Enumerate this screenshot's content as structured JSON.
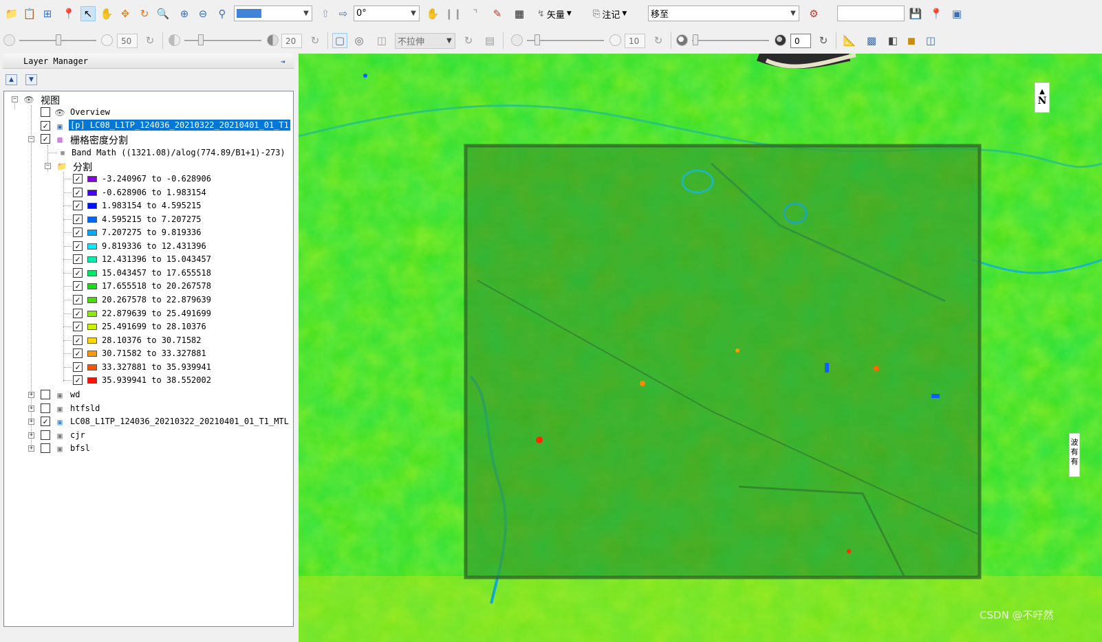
{
  "toolbar_top": {
    "icons": [
      "open-folder-icon",
      "clipboard-icon",
      "crop-icon",
      "pushpin-icon",
      "select-arrow-icon",
      "hand-pan-icon",
      "move-icon",
      "rotate-icon",
      "zoom-icon",
      "zoom-in-icon",
      "zoom-out-icon",
      "zoom-extent-icon"
    ],
    "zoom_combo_value": "",
    "rotation_combo_value": "0°",
    "vector_label": "矢量",
    "annotation_label": "注记",
    "goto_combo_value": "移至",
    "goto_input_value": ""
  },
  "toolbar_bottom": {
    "brightness_value": "50",
    "contrast_value": "20",
    "stretch_combo_value": "不拉伸",
    "sharpen_value": "10",
    "transparency_value": "0"
  },
  "layer_manager": {
    "title": "Layer Manager",
    "tree": {
      "root_label": "视图",
      "overview_label": "Overview",
      "selected_layer_label": "[p] LC08_L1TP_124036_20210322_20210401_01_T1",
      "density_slice_label": "栅格密度分割",
      "band_math_label": "Band Math ((1321.08)/alog(774.89/B1+1)-273)",
      "slices_folder_label": "分割",
      "slices": [
        {
          "label": "-3.240967 to -0.628906",
          "color": "#8a00e6"
        },
        {
          "label": "-0.628906 to 1.983154",
          "color": "#4400ff"
        },
        {
          "label": "1.983154 to 4.595215",
          "color": "#0011ff"
        },
        {
          "label": "4.595215 to 7.207275",
          "color": "#0066ff"
        },
        {
          "label": "7.207275 to 9.819336",
          "color": "#00aaff"
        },
        {
          "label": "9.819336 to 12.431396",
          "color": "#00eeff"
        },
        {
          "label": "12.431396 to 15.043457",
          "color": "#00f0b0"
        },
        {
          "label": "15.043457 to 17.655518",
          "color": "#00e666"
        },
        {
          "label": "17.655518 to 20.267578",
          "color": "#11e011"
        },
        {
          "label": "20.267578 to 22.879639",
          "color": "#44e000"
        },
        {
          "label": "22.879639 to 25.491699",
          "color": "#88ee00"
        },
        {
          "label": "25.491699 to 28.10376",
          "color": "#ccf200"
        },
        {
          "label": "28.10376 to 30.71582",
          "color": "#ffd700"
        },
        {
          "label": "30.71582 to 33.327881",
          "color": "#ff9900"
        },
        {
          "label": "33.327881 to 35.939941",
          "color": "#ff5500"
        },
        {
          "label": "35.939941 to 38.552002",
          "color": "#ff1100"
        }
      ],
      "other_layers": [
        {
          "label": "wd",
          "checked": false
        },
        {
          "label": "htfsld",
          "checked": false
        },
        {
          "label": "LC08_L1TP_124036_20210322_20210401_01_T1_MTL",
          "checked": true
        },
        {
          "label": "cjr",
          "checked": false
        },
        {
          "label": "bfsl",
          "checked": false
        }
      ]
    }
  },
  "map": {
    "north_label": "N",
    "side_tab_text": "波有有",
    "watermark": "CSDN @不吁然",
    "base_color": "#46e01f",
    "urban_color": "#56b322"
  }
}
